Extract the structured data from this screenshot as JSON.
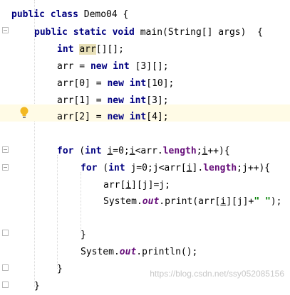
{
  "code": {
    "class_decl": {
      "kw": "public class",
      "name": "Demo04",
      "brace": "{"
    },
    "main_decl": {
      "kw": "public static void",
      "rest": "main(String[] args)  {"
    },
    "l3": {
      "kw": "int",
      "var": "arr",
      "rest": "[][];"
    },
    "l4": {
      "pre": "arr = ",
      "kw1": "new",
      "kw2": "int",
      "rest": " [3][];"
    },
    "l5": {
      "pre": "arr[0] = ",
      "kw1": "new",
      "kw2": "int",
      "rest": "[10];"
    },
    "l6": {
      "pre": "arr[1] = ",
      "kw1": "new",
      "kw2": "int",
      "rest": "[3];"
    },
    "l7": {
      "pre": "arr[2] = ",
      "kw1": "new",
      "kw2": "int",
      "rest": "[4];"
    },
    "l9": {
      "kw1": "for",
      "p1": " (",
      "kw2": "int",
      "v1": "i",
      "p2": "=0;",
      "v2": "i",
      "p3": "<arr.",
      "fld": "length",
      "p4": ";",
      "v3": "i",
      "p5": "++){"
    },
    "l10": {
      "kw1": "for",
      "p1": " (",
      "kw2": "int",
      "p2": " j=0;j<arr[",
      "v1": "i",
      "p3": "].",
      "fld": "length",
      "p4": ";j++){"
    },
    "l11": {
      "p1": "arr[",
      "v1": "i",
      "p2": "][j]=j;"
    },
    "l12": {
      "p1": "System.",
      "out": "out",
      "p2": ".print(arr[",
      "v1": "i",
      "p3": "][j]+",
      "str": "\" \"",
      "p4": ");"
    },
    "l14": {
      "text": "}"
    },
    "l15": {
      "p1": "System.",
      "out": "out",
      "p2": ".println();"
    },
    "l16": {
      "text": "}"
    },
    "l17": {
      "text": "}"
    }
  },
  "watermark": "https://blog.csdn.net/ssy052085156",
  "colors": {
    "keyword": "#000080",
    "field": "#660e7a",
    "string": "#008000",
    "highlight_line": "#fffbe6"
  },
  "icons": {
    "intention": "lightbulb-icon"
  }
}
